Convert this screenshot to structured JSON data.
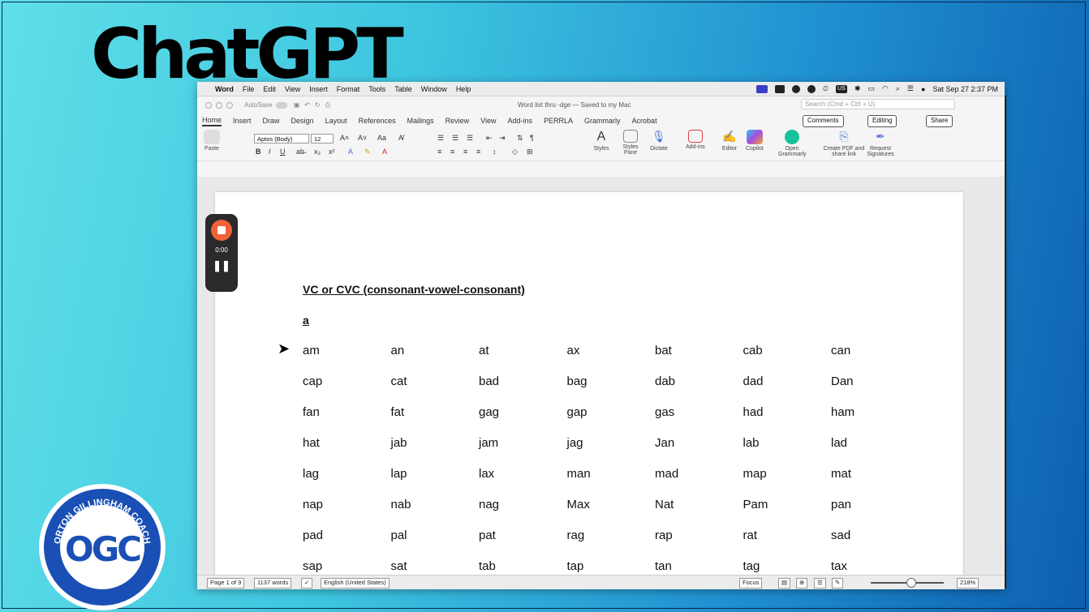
{
  "slide": {
    "title": "ChatGPT"
  },
  "menubar": {
    "items": [
      "Word",
      "File",
      "Edit",
      "View",
      "Insert",
      "Format",
      "Tools",
      "Table",
      "Window",
      "Help"
    ],
    "keyboard": "US",
    "datetime": "Sat Sep 27  2:37 PM"
  },
  "titlebar": {
    "autosave": "AutoSave",
    "document": "Word list thru -dge — Saved to my Mac",
    "search_placeholder": "Search (Cmd + Ctrl + U)"
  },
  "ribbon_tabs": [
    "Home",
    "Insert",
    "Draw",
    "Design",
    "Layout",
    "References",
    "Mailings",
    "Review",
    "View",
    "Add-ins",
    "PERRLA",
    "Grammarly",
    "Acrobat"
  ],
  "ribbon_buttons": {
    "comments": "Comments",
    "editing": "Editing",
    "share": "Share"
  },
  "ribbon": {
    "paste": "Paste",
    "font_name": "Aptos (Body)",
    "font_size": "12",
    "styles": "Styles",
    "styles_pane": "Styles Pane",
    "dictate": "Dictate",
    "addins": "Add-ins",
    "editor": "Editor",
    "copilot": "Copilot",
    "grammarly": "Open Grammarly",
    "create_pdf": "Create PDF and share link",
    "request_sig": "Request Signatures"
  },
  "document": {
    "heading": "VC or CVC (consonant-vowel-consonant)",
    "letter": "a",
    "words": [
      [
        "am",
        "an",
        "at",
        "ax",
        "bat",
        "cab",
        "can"
      ],
      [
        "cap",
        "cat",
        "bad",
        "bag",
        "dab",
        "dad",
        "Dan"
      ],
      [
        "fan",
        "fat",
        "gag",
        "gap",
        "gas",
        "had",
        "ham"
      ],
      [
        "hat",
        "jab",
        "jam",
        "jag",
        "Jan",
        "lab",
        "lad"
      ],
      [
        "lag",
        "lap",
        "lax",
        "man",
        "mad",
        "map",
        "mat"
      ],
      [
        "nap",
        "nab",
        "nag",
        "Max",
        "Nat",
        "Pam",
        "pan"
      ],
      [
        "pad",
        "pal",
        "pat",
        "rag",
        "rap",
        "rat",
        "sad"
      ],
      [
        "sap",
        "sat",
        "tab",
        "tap",
        "tan",
        "tag",
        "tax"
      ]
    ]
  },
  "statusbar": {
    "page": "Page 1 of 9",
    "words": "1137 words",
    "language": "English (United States)",
    "focus": "Focus",
    "zoom": "218%"
  },
  "recorder": {
    "time": "0:00"
  },
  "badge": {
    "monogram": "OGC",
    "ring_text": "ORTON GILLINGHAM COACH"
  }
}
